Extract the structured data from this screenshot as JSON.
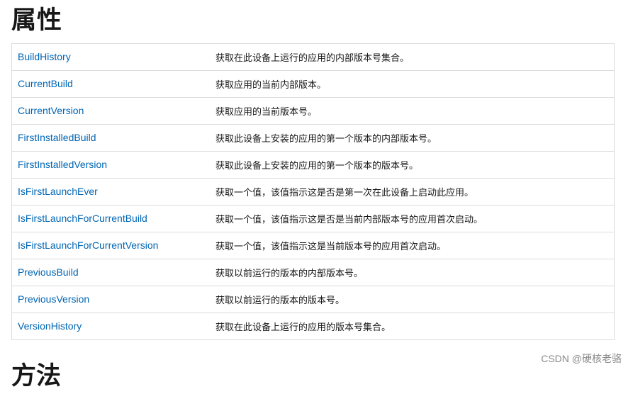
{
  "page": {
    "title": "属性",
    "next_heading": "方法"
  },
  "properties": [
    {
      "name": "BuildHistory",
      "description": "获取在此设备上运行的应用的内部版本号集合。"
    },
    {
      "name": "CurrentBuild",
      "description": "获取应用的当前内部版本。"
    },
    {
      "name": "CurrentVersion",
      "description": "获取应用的当前版本号。"
    },
    {
      "name": "FirstInstalledBuild",
      "description": "获取此设备上安装的应用的第一个版本的内部版本号。"
    },
    {
      "name": "FirstInstalledVersion",
      "description": "获取此设备上安装的应用的第一个版本的版本号。"
    },
    {
      "name": "IsFirstLaunchEver",
      "description": "获取一个值，该值指示这是否是第一次在此设备上启动此应用。"
    },
    {
      "name": "IsFirstLaunchForCurrentBuild",
      "description": "获取一个值，该值指示这是否是当前内部版本号的应用首次启动。"
    },
    {
      "name": "IsFirstLaunchForCurrentVersion",
      "description": "获取一个值，该值指示这是当前版本号的应用首次启动。"
    },
    {
      "name": "PreviousBuild",
      "description": "获取以前运行的版本的内部版本号。"
    },
    {
      "name": "PreviousVersion",
      "description": "获取以前运行的版本的版本号。"
    },
    {
      "name": "VersionHistory",
      "description": "获取在此设备上运行的应用的版本号集合。"
    }
  ],
  "watermark": "CSDN @硬核老骆",
  "colors": {
    "link": "#0065b3",
    "border": "#dcdcdc",
    "text": "#171717"
  }
}
